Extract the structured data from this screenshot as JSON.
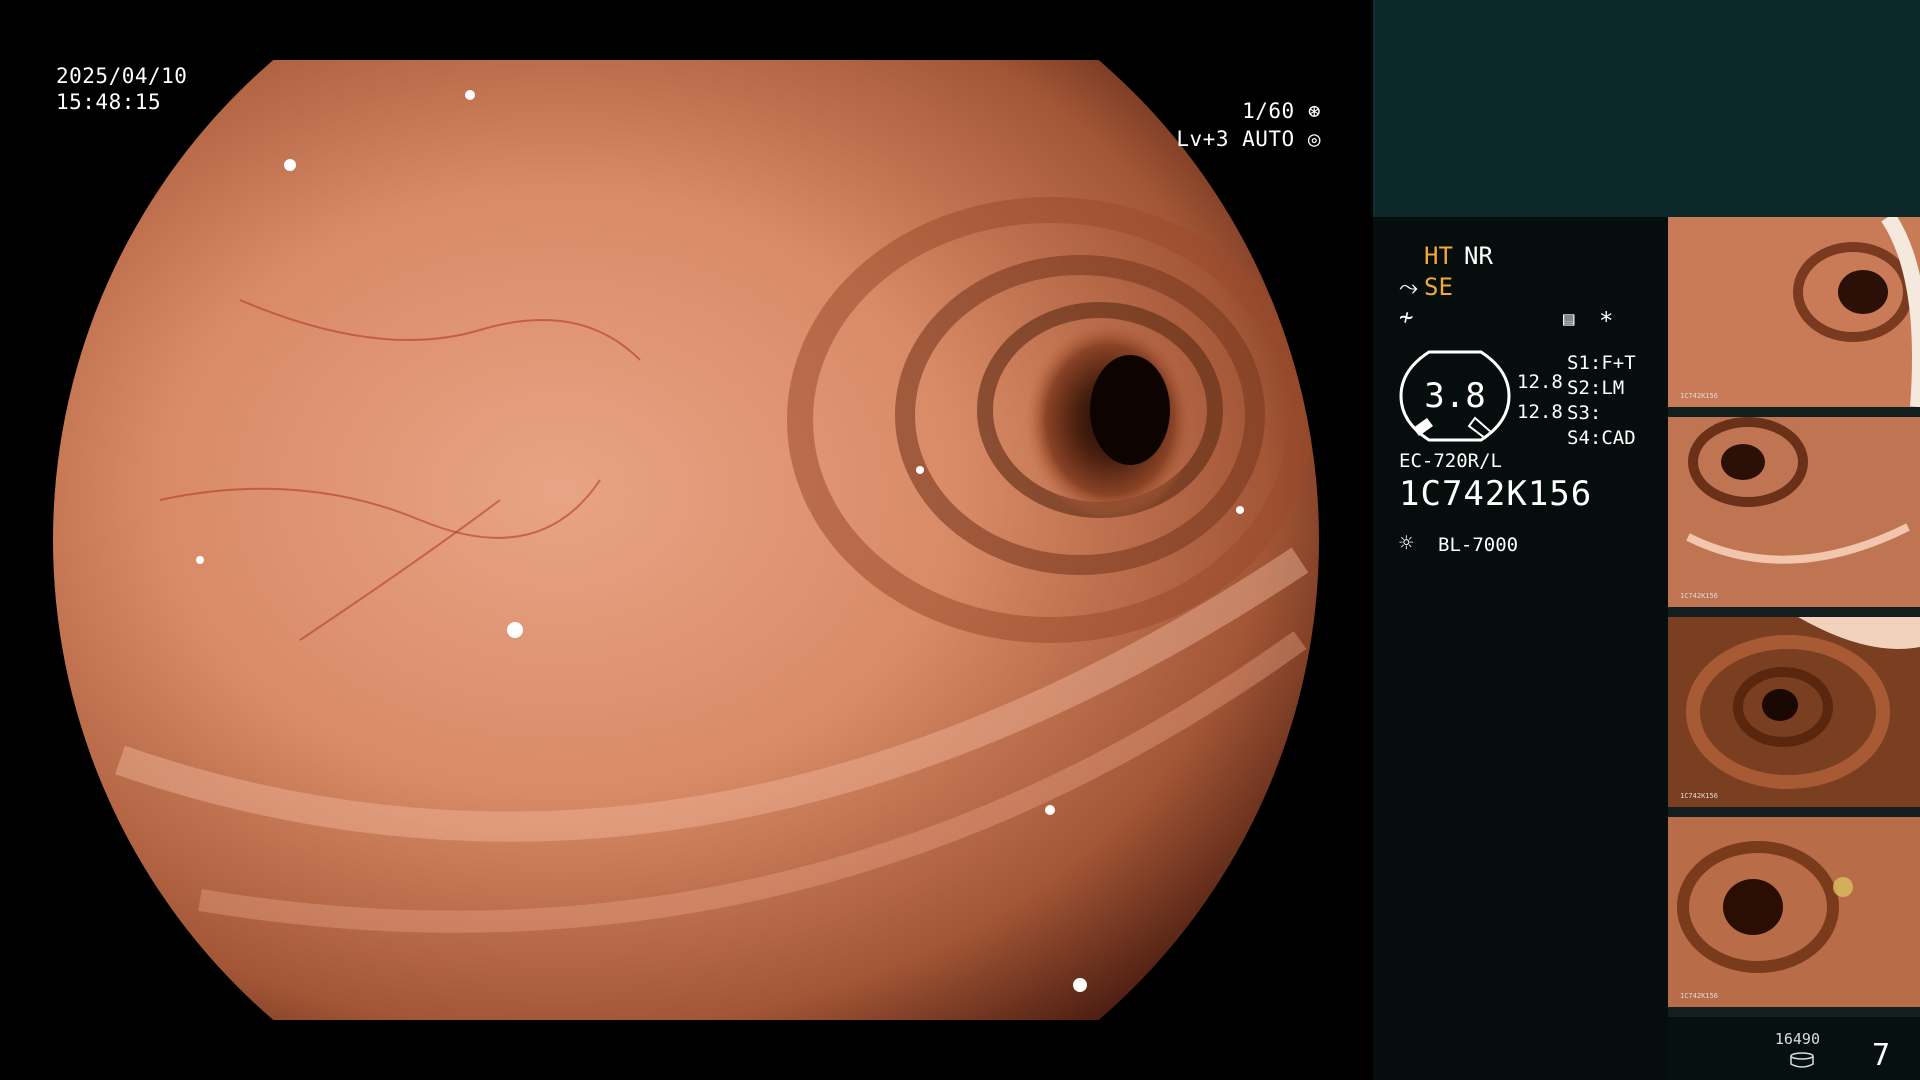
{
  "osd": {
    "date": "2025/04/10",
    "time": "15:48:15",
    "shutter": "1/60",
    "level": "Lv+3 AUTO"
  },
  "panel": {
    "ht": "HT",
    "nr": "NR",
    "se": "SE",
    "gauge_value": "3.8",
    "gauge_top": "12.8",
    "gauge_bottom": "12.8",
    "s1": "S1:",
    "s1_val": "F+T",
    "s2": "S2:",
    "s2_val": "LM",
    "s3": "S3:",
    "s3_val": "",
    "s4": "S4:",
    "s4_val": "CAD",
    "scope_model": "EC-720R/L",
    "serial": "1C742K156",
    "light_source": "BL-7000",
    "asterisk": "*"
  },
  "thumbnails": [
    {
      "id": "thumb-1",
      "label": "1C742K156"
    },
    {
      "id": "thumb-2",
      "label": "1C742K156"
    },
    {
      "id": "thumb-3",
      "label": "1C742K156"
    },
    {
      "id": "thumb-4",
      "label": "1C742K156"
    }
  ],
  "footer": {
    "count": "16490",
    "page": "7"
  },
  "colors": {
    "accent": "#f2a937",
    "panel_top": "#0c2829",
    "panel_bg": "#060d0d"
  },
  "icons": [
    "shutter-icon",
    "auto-iris-icon",
    "scissor-icon",
    "freq-icon",
    "settings-card-icon",
    "light-source-icon",
    "disk-icon"
  ]
}
